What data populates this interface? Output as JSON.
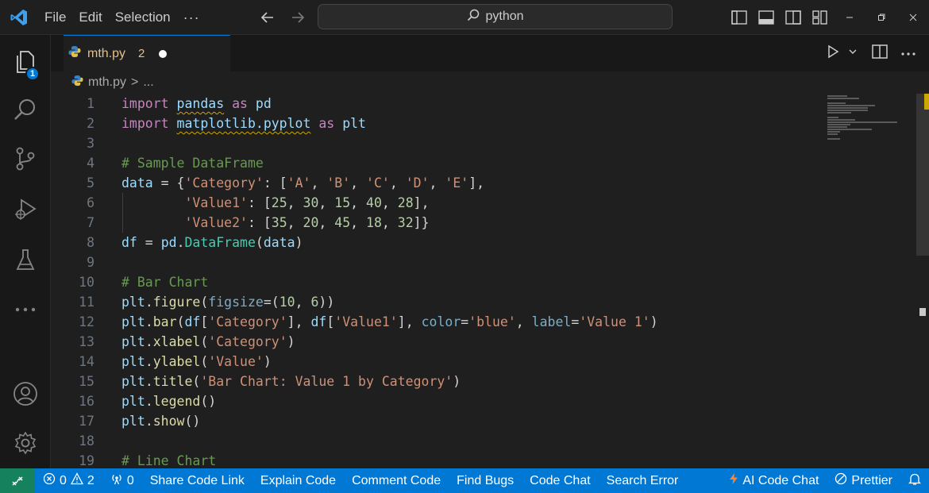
{
  "titlebar": {
    "menu": [
      "File",
      "Edit",
      "Selection"
    ],
    "more": "···",
    "search_text": "python"
  },
  "activity": {
    "explorer_badge": "1"
  },
  "tab": {
    "filename": "mth.py",
    "problems": "2",
    "modified": true
  },
  "breadcrumb": {
    "file": "mth.py",
    "sep": ">",
    "more": "..."
  },
  "code_lines": [
    {
      "n": "1",
      "tokens": [
        [
          "k",
          "import"
        ],
        [
          "p",
          " "
        ],
        [
          "v squig",
          "pandas"
        ],
        [
          "p",
          " "
        ],
        [
          "k",
          "as"
        ],
        [
          "p",
          " "
        ],
        [
          "v",
          "pd"
        ]
      ]
    },
    {
      "n": "2",
      "tokens": [
        [
          "k",
          "import"
        ],
        [
          "p",
          " "
        ],
        [
          "v squig",
          "matplotlib.pyplot"
        ],
        [
          "p",
          " "
        ],
        [
          "k",
          "as"
        ],
        [
          "p",
          " "
        ],
        [
          "v",
          "plt"
        ]
      ]
    },
    {
      "n": "3",
      "tokens": []
    },
    {
      "n": "4",
      "tokens": [
        [
          "c",
          "# Sample DataFrame"
        ]
      ]
    },
    {
      "n": "5",
      "tokens": [
        [
          "v",
          "data"
        ],
        [
          "p",
          " = {"
        ],
        [
          "s",
          "'Category'"
        ],
        [
          "p",
          ": ["
        ],
        [
          "s",
          "'A'"
        ],
        [
          "p",
          ", "
        ],
        [
          "s",
          "'B'"
        ],
        [
          "p",
          ", "
        ],
        [
          "s",
          "'C'"
        ],
        [
          "p",
          ", "
        ],
        [
          "s",
          "'D'"
        ],
        [
          "p",
          ", "
        ],
        [
          "s",
          "'E'"
        ],
        [
          "p",
          "],"
        ]
      ]
    },
    {
      "n": "6",
      "guide": true,
      "tokens": [
        [
          "p",
          "        "
        ],
        [
          "s",
          "'Value1'"
        ],
        [
          "p",
          ": ["
        ],
        [
          "n",
          "25"
        ],
        [
          "p",
          ", "
        ],
        [
          "n",
          "30"
        ],
        [
          "p",
          ", "
        ],
        [
          "n",
          "15"
        ],
        [
          "p",
          ", "
        ],
        [
          "n",
          "40"
        ],
        [
          "p",
          ", "
        ],
        [
          "n",
          "28"
        ],
        [
          "p",
          "],"
        ]
      ]
    },
    {
      "n": "7",
      "guide": true,
      "tokens": [
        [
          "p",
          "        "
        ],
        [
          "s",
          "'Value2'"
        ],
        [
          "p",
          ": ["
        ],
        [
          "n",
          "35"
        ],
        [
          "p",
          ", "
        ],
        [
          "n",
          "20"
        ],
        [
          "p",
          ", "
        ],
        [
          "n",
          "45"
        ],
        [
          "p",
          ", "
        ],
        [
          "n",
          "18"
        ],
        [
          "p",
          ", "
        ],
        [
          "n",
          "32"
        ],
        [
          "p",
          "]}"
        ]
      ]
    },
    {
      "n": "8",
      "tokens": [
        [
          "v",
          "df"
        ],
        [
          "p",
          " = "
        ],
        [
          "v",
          "pd"
        ],
        [
          "p",
          "."
        ],
        [
          "t",
          "DataFrame"
        ],
        [
          "p",
          "("
        ],
        [
          "v",
          "data"
        ],
        [
          "p",
          ")"
        ]
      ]
    },
    {
      "n": "9",
      "tokens": []
    },
    {
      "n": "10",
      "tokens": [
        [
          "c",
          "# Bar Chart"
        ]
      ]
    },
    {
      "n": "11",
      "tokens": [
        [
          "v",
          "plt"
        ],
        [
          "p",
          "."
        ],
        [
          "f",
          "figure"
        ],
        [
          "p",
          "("
        ],
        [
          "prm",
          "figsize"
        ],
        [
          "p",
          "=("
        ],
        [
          "n",
          "10"
        ],
        [
          "p",
          ", "
        ],
        [
          "n",
          "6"
        ],
        [
          "p",
          "))"
        ]
      ]
    },
    {
      "n": "12",
      "tokens": [
        [
          "v",
          "plt"
        ],
        [
          "p",
          "."
        ],
        [
          "f",
          "bar"
        ],
        [
          "p",
          "("
        ],
        [
          "v",
          "df"
        ],
        [
          "p",
          "["
        ],
        [
          "s",
          "'Category'"
        ],
        [
          "p",
          "], "
        ],
        [
          "v",
          "df"
        ],
        [
          "p",
          "["
        ],
        [
          "s",
          "'Value1'"
        ],
        [
          "p",
          "], "
        ],
        [
          "prm",
          "color"
        ],
        [
          "p",
          "="
        ],
        [
          "s",
          "'blue'"
        ],
        [
          "p",
          ", "
        ],
        [
          "prm",
          "label"
        ],
        [
          "p",
          "="
        ],
        [
          "s",
          "'Value 1'"
        ],
        [
          "p",
          ")"
        ]
      ]
    },
    {
      "n": "13",
      "tokens": [
        [
          "v",
          "plt"
        ],
        [
          "p",
          "."
        ],
        [
          "f",
          "xlabel"
        ],
        [
          "p",
          "("
        ],
        [
          "s",
          "'Category'"
        ],
        [
          "p",
          ")"
        ]
      ]
    },
    {
      "n": "14",
      "tokens": [
        [
          "v",
          "plt"
        ],
        [
          "p",
          "."
        ],
        [
          "f",
          "ylabel"
        ],
        [
          "p",
          "("
        ],
        [
          "s",
          "'Value'"
        ],
        [
          "p",
          ")"
        ]
      ]
    },
    {
      "n": "15",
      "tokens": [
        [
          "v",
          "plt"
        ],
        [
          "p",
          "."
        ],
        [
          "f",
          "title"
        ],
        [
          "p",
          "("
        ],
        [
          "s",
          "'Bar Chart: Value 1 by Category'"
        ],
        [
          "p",
          ")"
        ]
      ]
    },
    {
      "n": "16",
      "tokens": [
        [
          "v",
          "plt"
        ],
        [
          "p",
          "."
        ],
        [
          "f",
          "legend"
        ],
        [
          "p",
          "()"
        ]
      ]
    },
    {
      "n": "17",
      "tokens": [
        [
          "v",
          "plt"
        ],
        [
          "p",
          "."
        ],
        [
          "f",
          "show"
        ],
        [
          "p",
          "()"
        ]
      ]
    },
    {
      "n": "18",
      "tokens": []
    },
    {
      "n": "19",
      "tokens": [
        [
          "c",
          "# Line Chart"
        ]
      ]
    }
  ],
  "statusbar": {
    "errors": "0",
    "warnings": "2",
    "ports": "0",
    "items": [
      "Share Code Link",
      "Explain Code",
      "Comment Code",
      "Find Bugs",
      "Code Chat",
      "Search Error"
    ],
    "ai_chat": "AI Code Chat",
    "prettier": "Prettier"
  },
  "colors": {
    "accent": "#0078d4",
    "remote": "#16825d",
    "modified": "#e2c08d"
  }
}
